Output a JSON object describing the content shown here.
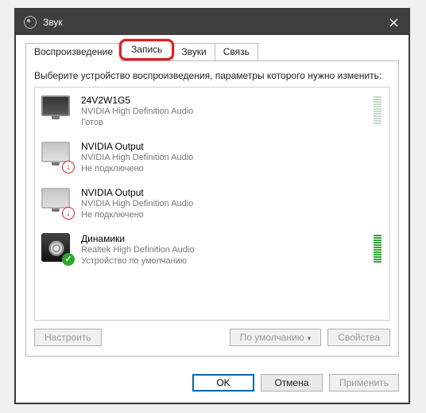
{
  "window": {
    "title": "Звук"
  },
  "tabs": {
    "t0": "Воспроизведение",
    "t1": "Запись",
    "t2": "Звуки",
    "t3": "Связь"
  },
  "panel": {
    "instruction": "Выберите устройство воспроизведения, параметры которого нужно изменить:"
  },
  "devices": [
    {
      "name": "24V2W1G5",
      "sub": "NVIDIA High Definition Audio",
      "status": "Готов"
    },
    {
      "name": "NVIDIA Output",
      "sub": "NVIDIA High Definition Audio",
      "status": "Не подключено"
    },
    {
      "name": "NVIDIA Output",
      "sub": "NVIDIA High Definition Audio",
      "status": "Не подключено"
    },
    {
      "name": "Динамики",
      "sub": "Realtek High Definition Audio",
      "status": "Устройство по умолчанию"
    }
  ],
  "buttons": {
    "configure": "Настроить",
    "default": "По умолчанию",
    "properties": "Свойства",
    "ok": "OK",
    "cancel": "Отмена",
    "apply": "Применить"
  }
}
